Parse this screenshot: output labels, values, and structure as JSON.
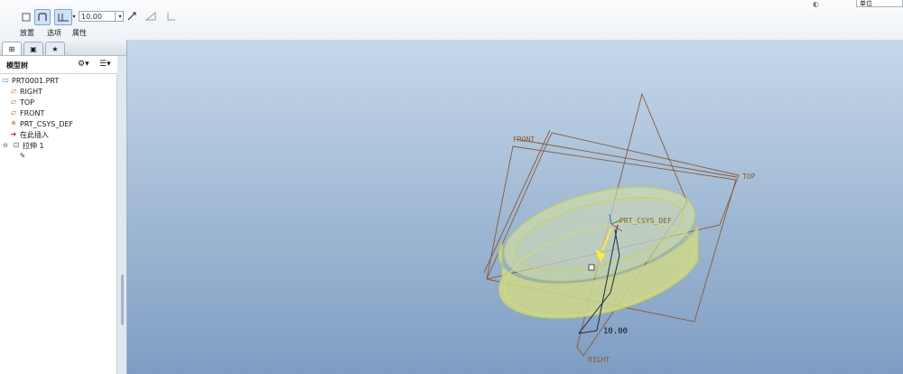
{
  "ribbon": {
    "depth_value": "10.00",
    "tabs": [
      "放置",
      "选项",
      "属性"
    ],
    "top_right_label": "单位"
  },
  "left_panel": {
    "tree_title": "模型树",
    "items": [
      {
        "label": "PRT0001.PRT",
        "icon": "part-icon"
      },
      {
        "label": "RIGHT",
        "icon": "datum-plane-icon"
      },
      {
        "label": "TOP",
        "icon": "datum-plane-icon"
      },
      {
        "label": "FRONT",
        "icon": "datum-plane-icon"
      },
      {
        "label": "PRT_CSYS_DEF",
        "icon": "csys-icon"
      },
      {
        "label": "在此插入",
        "icon": "insert-here-arrow-icon"
      },
      {
        "label": "拉伸 1",
        "icon": "extrude-icon"
      },
      {
        "label": "",
        "icon": "sketch-icon"
      }
    ]
  },
  "viewport": {
    "datum_labels": {
      "front": "FRONT",
      "top": "TOP",
      "right": "RIGHT",
      "csys": "PRT_CSYS_DEF"
    },
    "dimension": "10.00"
  },
  "colors": {
    "datum_plane": "#8a5a35",
    "extrude_fill": "#d9e27a",
    "viewport_top": "#c6d8ea",
    "viewport_bottom": "#7f9dc3"
  }
}
